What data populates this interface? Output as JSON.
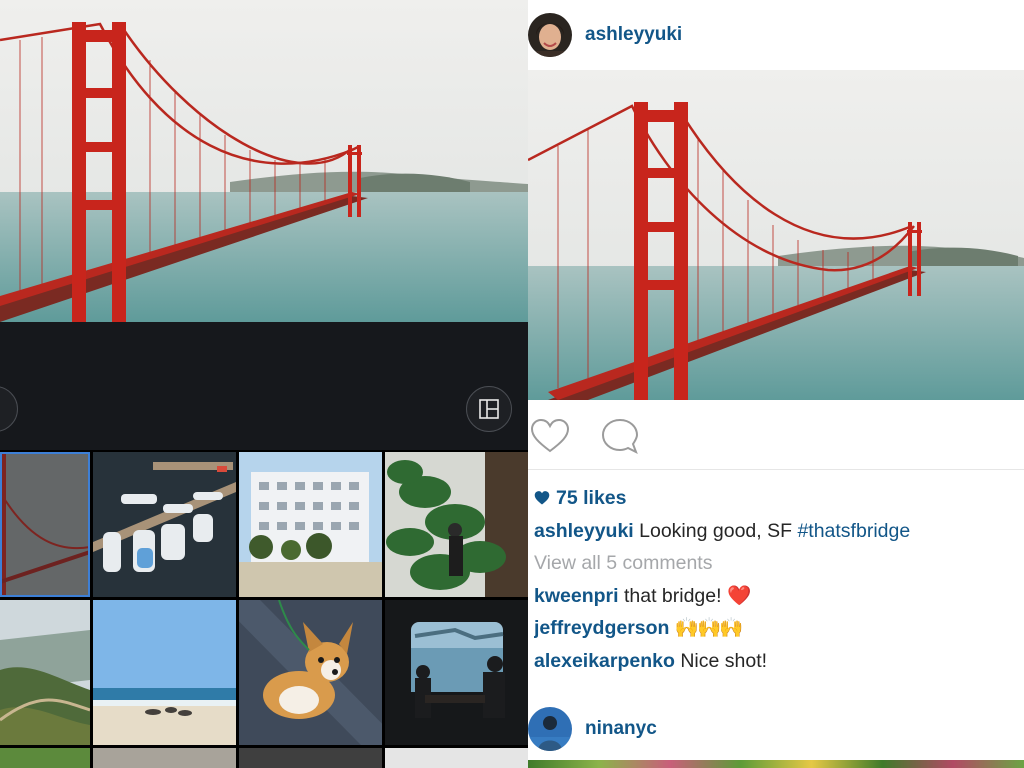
{
  "post": {
    "author": "ashleyyuki",
    "likes": "75 likes",
    "caption": {
      "user": "ashleyyuki",
      "text": " Looking good, SF ",
      "hashtag": "#thatsfbridge"
    },
    "view_all_comments": "View all 5 comments",
    "comments": [
      {
        "user": "kweenpri",
        "text": " that bridge! ",
        "emoji": "❤️"
      },
      {
        "user": "jeffreydgerson",
        "text": " ",
        "emoji": "🙌🙌🙌"
      },
      {
        "user": "alexeikarpenko",
        "text": " Nice shot!",
        "emoji": ""
      }
    ]
  },
  "next_post": {
    "author": "ninanyc"
  },
  "gallery": {
    "thumbnails": [
      "bridge-fog",
      "marina-boats",
      "white-apartment-building",
      "houseplant-interior",
      "coastal-hills",
      "beach-sea",
      "corgi-dog",
      "window-silhouettes"
    ],
    "selected_thumbnail": "bridge-fog"
  },
  "icons": {
    "left_round_button": "crop-icon",
    "right_round_button": "layout-icon",
    "like": "heart-outline-icon",
    "comment": "comment-bubble-icon",
    "likes_marker": "heart-filled-icon"
  },
  "colors": {
    "link_blue": "#125688",
    "bridge_red": "#c8251c",
    "selection_blue": "#3d7fd6",
    "dark_panel": "#16181c"
  }
}
